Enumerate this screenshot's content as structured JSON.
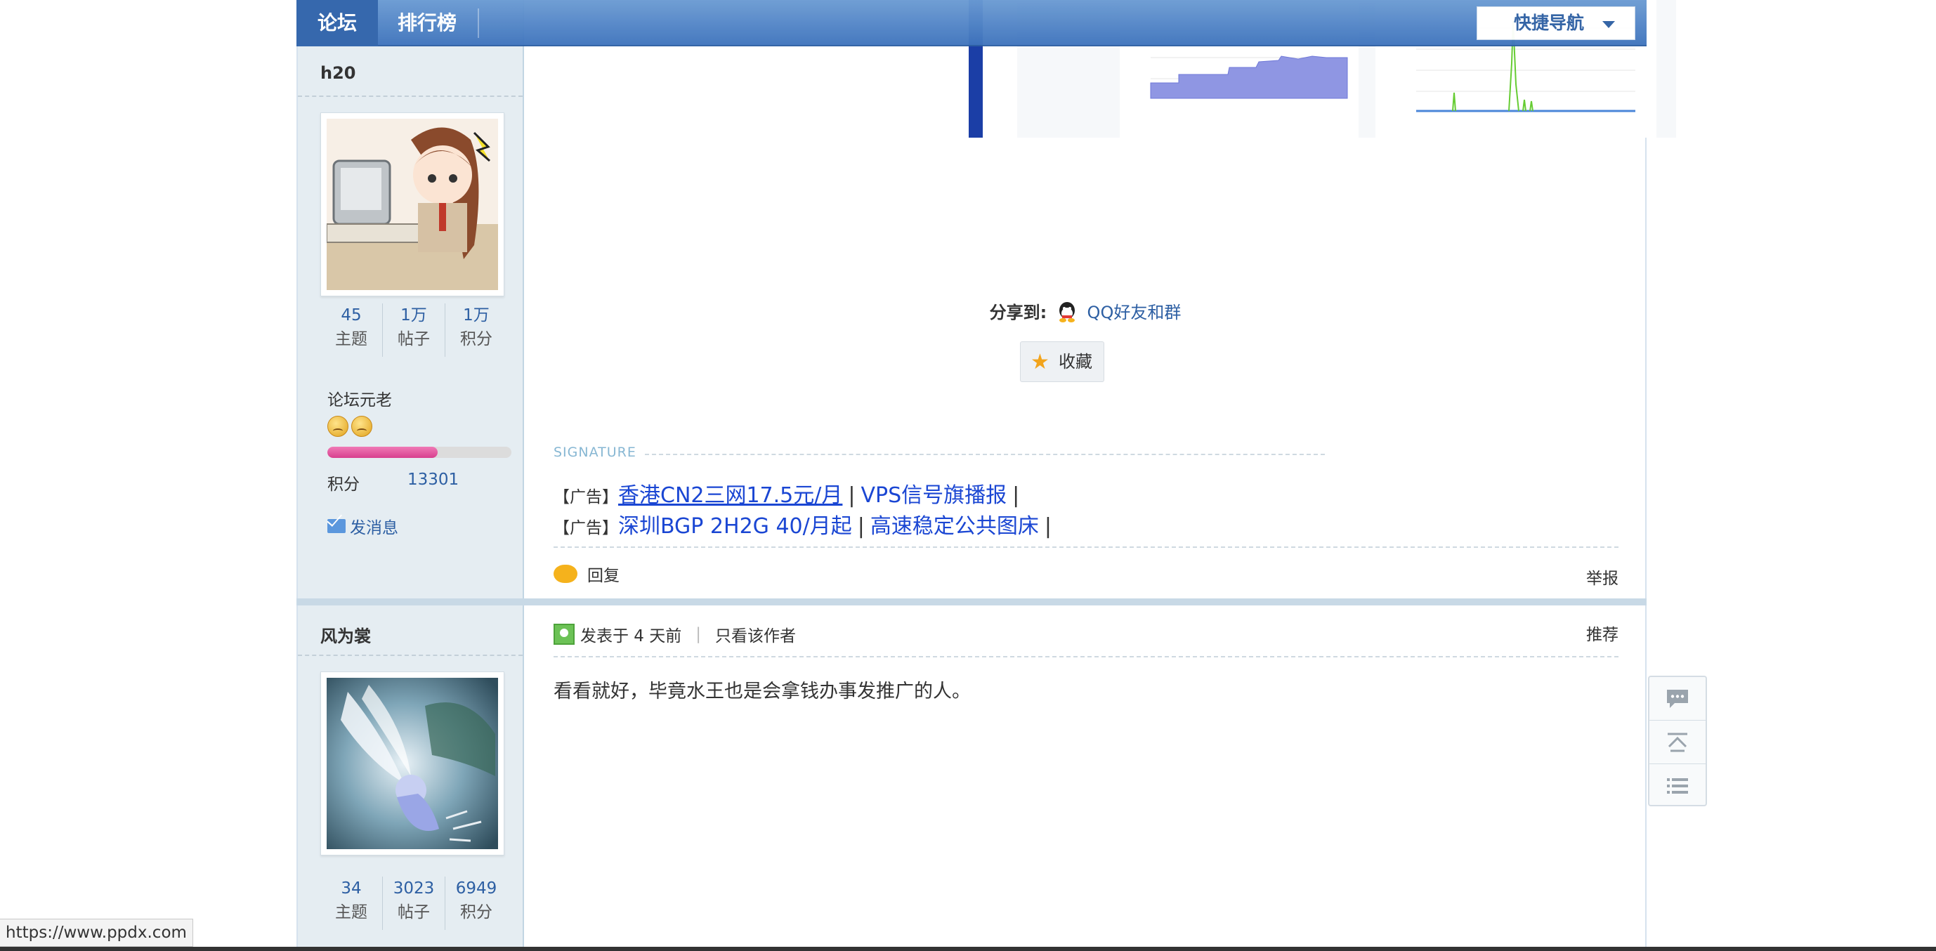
{
  "nav": {
    "items": [
      {
        "label": "论坛",
        "active": true
      },
      {
        "label": "排行榜",
        "active": false
      }
    ],
    "quick_nav_label": "快捷导航"
  },
  "users": [
    {
      "name": "h20",
      "stats": [
        {
          "value": "45",
          "label": "主题"
        },
        {
          "value": "1万",
          "label": "帖子"
        },
        {
          "value": "1万",
          "label": "积分"
        }
      ],
      "rank_title": "论坛元老",
      "level_progress_pct": 60,
      "score_label": "积分",
      "score_value": "13301",
      "message_label": "发消息"
    },
    {
      "name": "风为裳",
      "stats": [
        {
          "value": "34",
          "label": "主题"
        },
        {
          "value": "3023",
          "label": "帖子"
        },
        {
          "value": "6949",
          "label": "积分"
        }
      ]
    }
  ],
  "post1": {
    "share_label": "分享到:",
    "share_target": "QQ好友和群",
    "favorite_label": "收藏",
    "signature_label": "SIGNATURE",
    "ad_tag": "【广告】",
    "ads_row1": [
      "香港CN2三网17.5元/月",
      "VPS信号旗播报"
    ],
    "ads_row2": [
      "深圳BGP 2H2G 40/月起",
      "高速稳定公共图床"
    ],
    "reply_label": "回复",
    "report_label": "举报"
  },
  "post2": {
    "posted_label": "发表于 4 天前",
    "only_author_label": "只看该作者",
    "recommend_label": "推荐",
    "body": "看看就好，毕竟水王也是会拿钱办事发推广的人。"
  },
  "floatbar": [
    "comment-icon",
    "back-to-top-icon",
    "list-icon"
  ],
  "status_url": "https://www.ppdx.com",
  "colors": {
    "nav_blue": "#3f74bd",
    "link_blue": "#2d5fa3",
    "ad_link": "#1a46d3",
    "sidebar_bg": "#e5edf2"
  }
}
